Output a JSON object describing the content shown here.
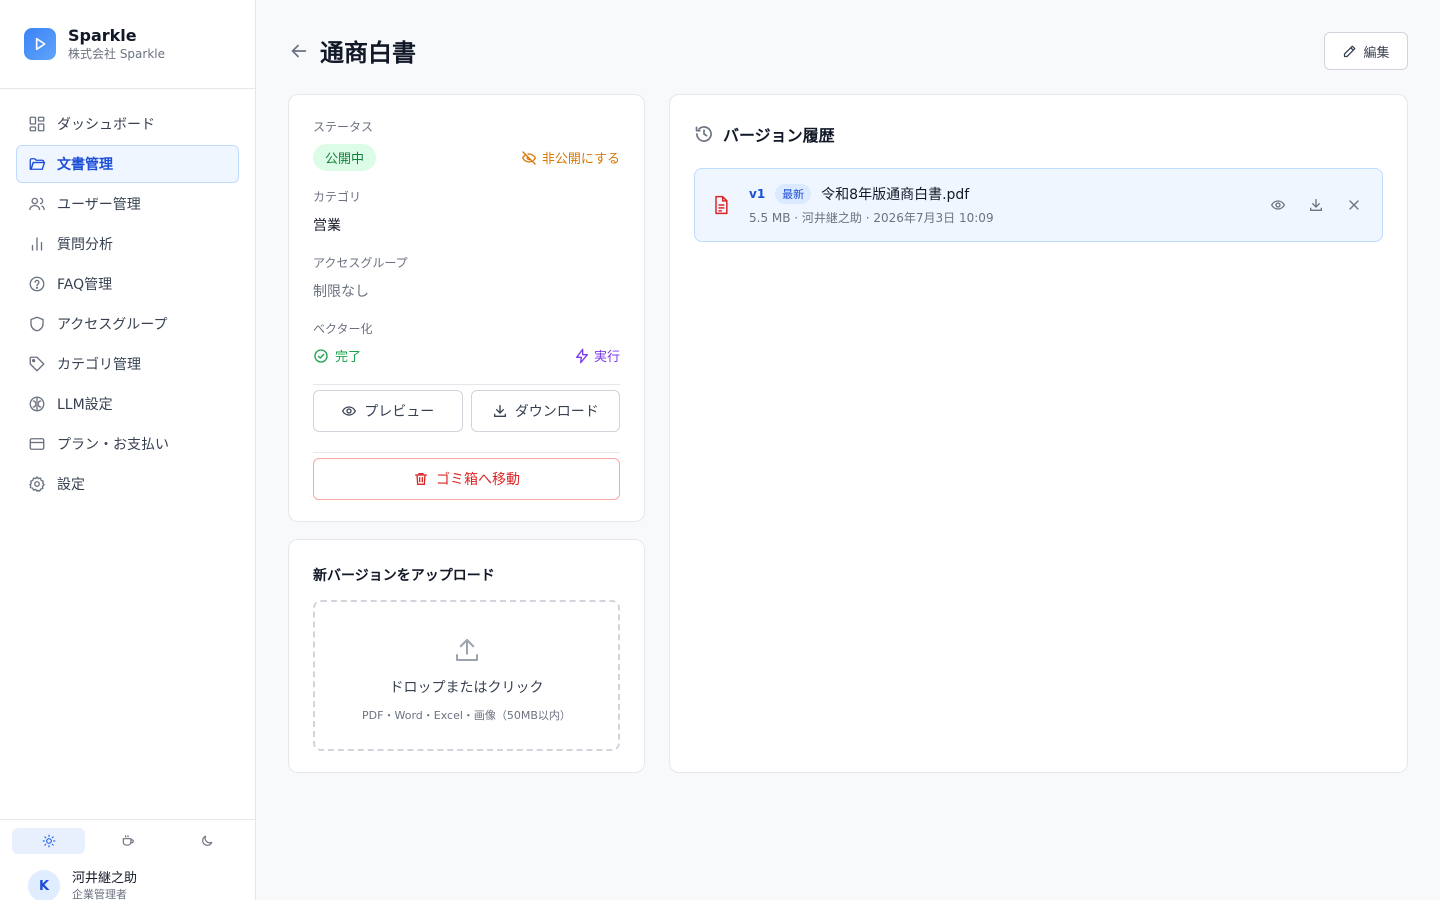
{
  "brand": {
    "name": "Sparkle",
    "company": "株式会社 Sparkle"
  },
  "sidebar": {
    "items": [
      {
        "label": "ダッシュボード",
        "icon": "dashboard-icon"
      },
      {
        "label": "文書管理",
        "icon": "folder-icon",
        "active": true
      },
      {
        "label": "ユーザー管理",
        "icon": "users-icon"
      },
      {
        "label": "質問分析",
        "icon": "bar-chart-icon"
      },
      {
        "label": "FAQ管理",
        "icon": "help-circle-icon"
      },
      {
        "label": "アクセスグループ",
        "icon": "shield-icon"
      },
      {
        "label": "カテゴリ管理",
        "icon": "tag-icon"
      },
      {
        "label": "LLM設定",
        "icon": "brain-icon"
      },
      {
        "label": "プラン・お支払い",
        "icon": "credit-card-icon"
      },
      {
        "label": "設定",
        "icon": "gear-icon"
      }
    ]
  },
  "theme": {
    "options": [
      "light",
      "coffee",
      "dark"
    ],
    "selected": "light"
  },
  "user": {
    "initial": "K",
    "name": "河井継之助",
    "role": "企業管理者"
  },
  "header": {
    "title": "通商白書",
    "edit_label": "編集"
  },
  "info": {
    "status_label": "ステータス",
    "status_value": "公開中",
    "unpublish_label": "非公開にする",
    "category_label": "カテゴリ",
    "category_value": "営業",
    "access_label": "アクセスグループ",
    "access_value": "制限なし",
    "vector_label": "ベクター化",
    "vector_value": "完了",
    "execute_label": "実行",
    "preview_label": "プレビュー",
    "download_label": "ダウンロード",
    "trash_label": "ゴミ箱へ移動"
  },
  "upload": {
    "title": "新バージョンをアップロード",
    "drop_text": "ドロップまたはクリック",
    "hint": "PDF・Word・Excel・画像（50MB以内）"
  },
  "history": {
    "title": "バージョン履歴",
    "versions": [
      {
        "version": "v1",
        "badge": "最新",
        "filename": "令和8年版通商白書.pdf",
        "meta": "5.5 MB · 河井継之助 · 2026年7月3日 10:09"
      }
    ]
  },
  "colors": {
    "accent": "#2563eb",
    "success": "#16a34a",
    "warning": "#d97706",
    "danger": "#dc2626",
    "vector_accent": "#7c3aed"
  }
}
